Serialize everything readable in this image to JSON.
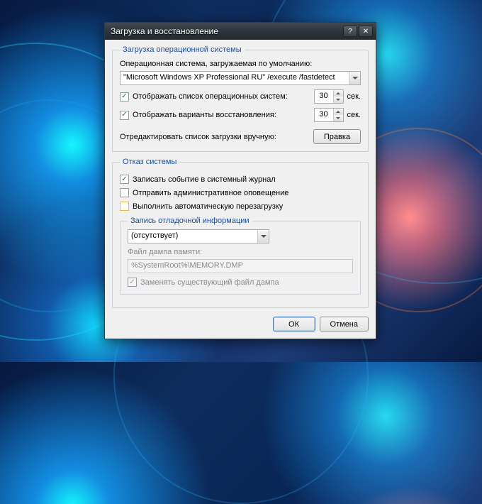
{
  "dialog": {
    "title": "Загрузка и восстановление"
  },
  "startup": {
    "legend": "Загрузка операционной системы",
    "default_os_label": "Операционная система, загружаемая по умолчанию:",
    "default_os_value": "\"Microsoft Windows XP Professional RU\" /execute /fastdetect",
    "show_os_list_label": "Отображать список операционных систем:",
    "show_os_list_value": "30",
    "show_recovery_label": "Отображать варианты восстановления:",
    "show_recovery_value": "30",
    "sec_suffix": "сек.",
    "edit_manually_label": "Отредактировать список загрузки вручную:",
    "edit_button": "Правка"
  },
  "failure": {
    "legend": "Отказ системы",
    "write_event_label": "Записать событие в системный журнал",
    "admin_alert_label": "Отправить административное оповещение",
    "auto_restart_label": "Выполнить автоматическую перезагрузку"
  },
  "debug": {
    "legend": "Запись отладочной информации",
    "type_value": "(отсутствует)",
    "dump_file_label": "Файл дампа памяти:",
    "dump_file_value": "%SystemRoot%\\MEMORY.DMP",
    "overwrite_label": "Заменять существующий файл дампа"
  },
  "buttons": {
    "ok": "ОК",
    "cancel": "Отмена"
  }
}
